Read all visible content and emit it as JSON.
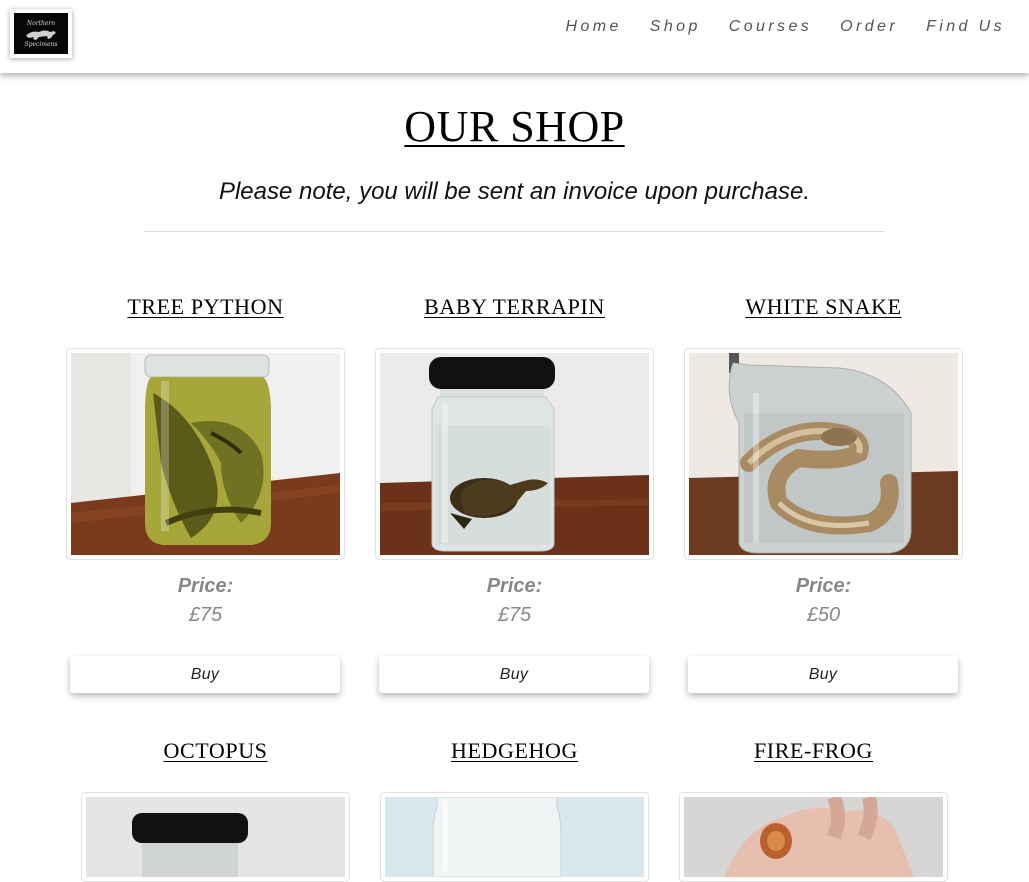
{
  "brand": {
    "logo_lines": [
      "Northern",
      "Specimens"
    ]
  },
  "nav": {
    "items": [
      "Home",
      "Shop",
      "Courses",
      "Order",
      "Find Us"
    ]
  },
  "page": {
    "title": "OUR SHOP",
    "note": "Please note, you will be sent an invoice upon purchase."
  },
  "products": [
    {
      "name": "TREE PYTHON",
      "price_label": "Price:",
      "price": "£75",
      "buy_label": "Buy",
      "image": "tree-python-jar-photo"
    },
    {
      "name": "BABY TERRAPIN",
      "price_label": "Price:",
      "price": "£75",
      "buy_label": "Buy",
      "image": "baby-terrapin-jar-photo"
    },
    {
      "name": "WHITE SNAKE",
      "price_label": "Price:",
      "price": "£50",
      "buy_label": "Buy",
      "image": "white-snake-jar-photo"
    },
    {
      "name": "OCTOPUS",
      "image": "octopus-jar-photo"
    },
    {
      "name": "HEDGEHOG",
      "image": "hedgehog-jar-photo"
    },
    {
      "name": "FIRE-FROG",
      "image": "fire-frog-in-hand-photo"
    }
  ],
  "colors": {
    "nav_text": "#555555",
    "price_text": "#888888",
    "divider": "#dcdcdc"
  }
}
